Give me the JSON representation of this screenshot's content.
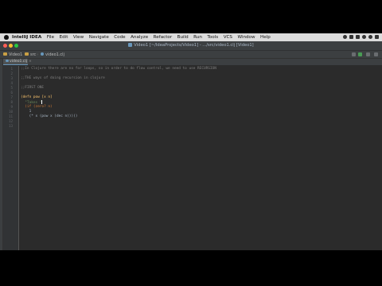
{
  "menubar": {
    "app": "IntelliJ IDEA",
    "items": [
      "File",
      "Edit",
      "View",
      "Navigate",
      "Code",
      "Analyze",
      "Refactor",
      "Build",
      "Run",
      "Tools",
      "VCS",
      "Window",
      "Help"
    ]
  },
  "window": {
    "title": "Video1 [~/IdeaProjects/Video1] - .../src/video1.clj [Video1]"
  },
  "breadcrumbs": [
    "Video1",
    "src",
    "video1.clj"
  ],
  "tabs": [
    {
      "label": "video1.clj"
    }
  ],
  "editor": {
    "lines": [
      {
        "num": "1",
        "text": ";;In Clojure there are no for loops, so in order to do flow control, we need to use RECURSION"
      },
      {
        "num": "2",
        "text": ""
      },
      {
        "num": "3",
        "text": ";;THE ways of doing recursion in clojure"
      },
      {
        "num": "4",
        "text": ""
      },
      {
        "num": "5",
        "text": ";;FIRST ONE"
      },
      {
        "num": "6",
        "text": ""
      },
      {
        "num": "7",
        "text": "(defn pow [x n]"
      },
      {
        "num": "8",
        "text": "  \"Takes \""
      },
      {
        "num": "9",
        "text": "  (if (zero? n)"
      },
      {
        "num": "10",
        "text": "    1"
      },
      {
        "num": "11",
        "text": "    (* x (pow x (dec n)))))"
      },
      {
        "num": "12",
        "text": ""
      },
      {
        "num": "13",
        "text": ""
      }
    ]
  },
  "colors": {
    "editor_bg": "#2b2b2b",
    "gutter_bg": "#313335",
    "comment": "#808080",
    "keyword": "#cc7832",
    "function_name": "#ffc66d",
    "string": "#6a8759",
    "text": "#a9b7c6"
  }
}
